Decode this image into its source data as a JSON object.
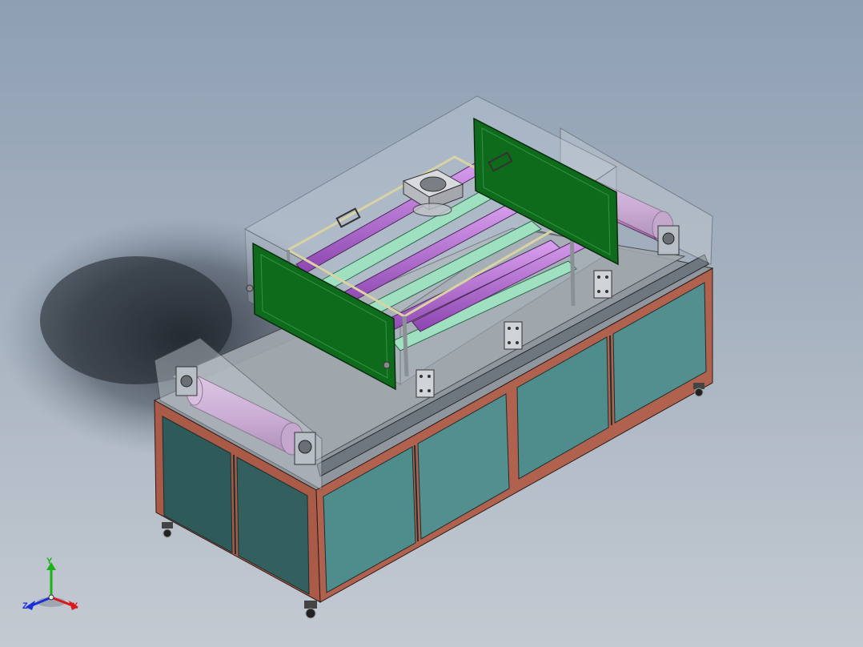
{
  "viewport": {
    "background_top": "#8e9fb3",
    "background_bottom": "#c4cad2"
  },
  "model": {
    "frame_color": "#b0624f",
    "panel_color_light": "#4f8c8c",
    "panel_color_dark": "#2f5a5a",
    "roller_color": "#d49ad8",
    "tube_color": "#b06ad0",
    "rail_color": "#9fe0c0",
    "board_color": "#0f6b1c",
    "enclosure_color": "#c9d3de"
  },
  "triad": {
    "y_label": "Y",
    "z_label": "Z",
    "x_label": "X",
    "y_color": "#19b319",
    "z_color": "#1a2fd8",
    "x_color": "#d81a1a"
  }
}
